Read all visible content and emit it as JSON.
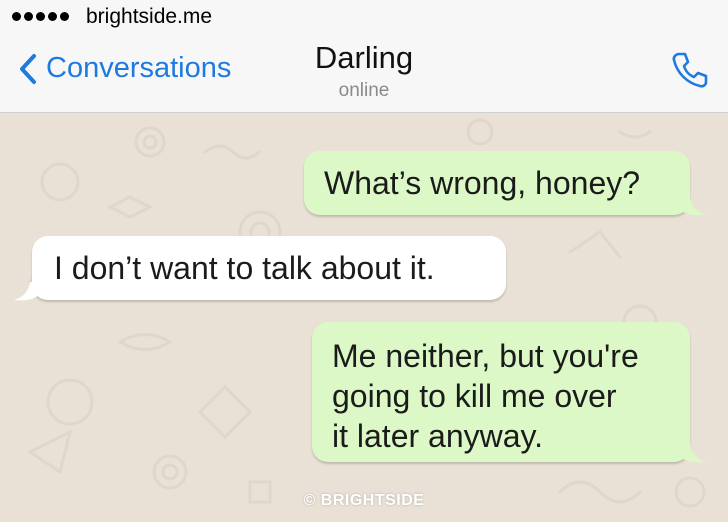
{
  "status_bar": {
    "signal_dots": 5,
    "carrier": "brightside.me"
  },
  "nav": {
    "back_label": "Conversations",
    "contact_name": "Darling",
    "contact_status": "online",
    "back_icon": "chevron-left-icon",
    "call_icon": "phone-icon",
    "accent_color": "#1f7ae0"
  },
  "messages": [
    {
      "direction": "outgoing",
      "text": "What’s wrong, honey?"
    },
    {
      "direction": "incoming",
      "text": "I don’t want to talk about it."
    },
    {
      "direction": "outgoing",
      "text": "Me neither, but you're\ngoing to kill me over\nit later anyway."
    }
  ],
  "watermark": "© BRIGHTSIDE",
  "colors": {
    "outgoing_bubble": "#dcf8c6",
    "incoming_bubble": "#ffffff",
    "chat_background": "#e9e1d6"
  }
}
